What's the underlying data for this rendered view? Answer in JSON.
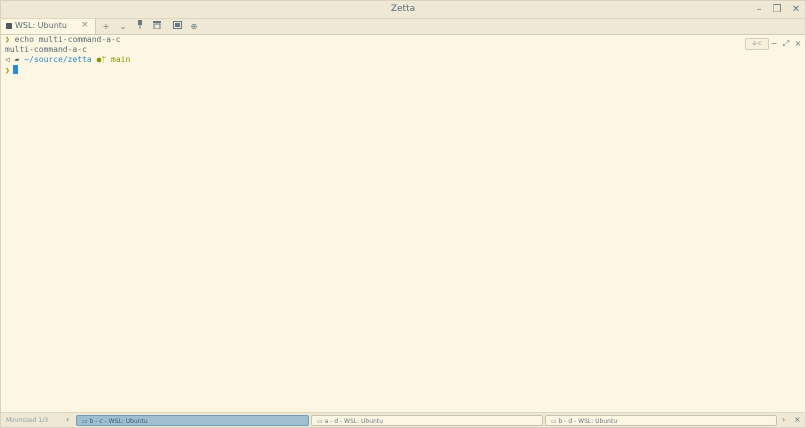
{
  "window": {
    "title": "Zetta",
    "minimize_icon": "minimize-icon",
    "maximize_icon": "restore-icon",
    "close_icon": "close-icon"
  },
  "tabs": [
    {
      "label": "WSL: Ubuntu",
      "icon": "terminal-icon",
      "close_symbol": "×"
    }
  ],
  "toolbar": {
    "new_tab": "+",
    "dropdown": "⌄",
    "pin": "🖈",
    "archive": "≡",
    "split": "▭",
    "globe": "⊕"
  },
  "terminal": {
    "lines": [
      {
        "prompt": "❯",
        "text": " echo multi-command-a-c"
      },
      {
        "prompt": "",
        "text": "multi-command-a-c"
      }
    ],
    "prompt_line": {
      "os_icon": "penguin-icon",
      "folder_icon": "folder-icon",
      "path": "~/source/zetta",
      "git_icon": "git-branch-icon",
      "branch": "main"
    },
    "input_prompt": "❯"
  },
  "pane": {
    "label": "a-c",
    "minimize": "−",
    "expand": "⤢",
    "close": "×"
  },
  "bottombar": {
    "minimized_label": "Minimized 1/3",
    "prev": "‹",
    "next": "›",
    "close": "×",
    "items": [
      {
        "label": "b - c - WSL: Ubuntu",
        "active": true
      },
      {
        "label": "a - d - WSL: Ubuntu",
        "active": false
      },
      {
        "label": "b - d - WSL: Ubuntu",
        "active": false
      }
    ]
  },
  "colors": {
    "background": "#fdf6e3",
    "chrome": "#eee8d5",
    "prompt_green": "#859900",
    "path_blue": "#268bd2",
    "active_minimized": "#9fbfd0"
  }
}
